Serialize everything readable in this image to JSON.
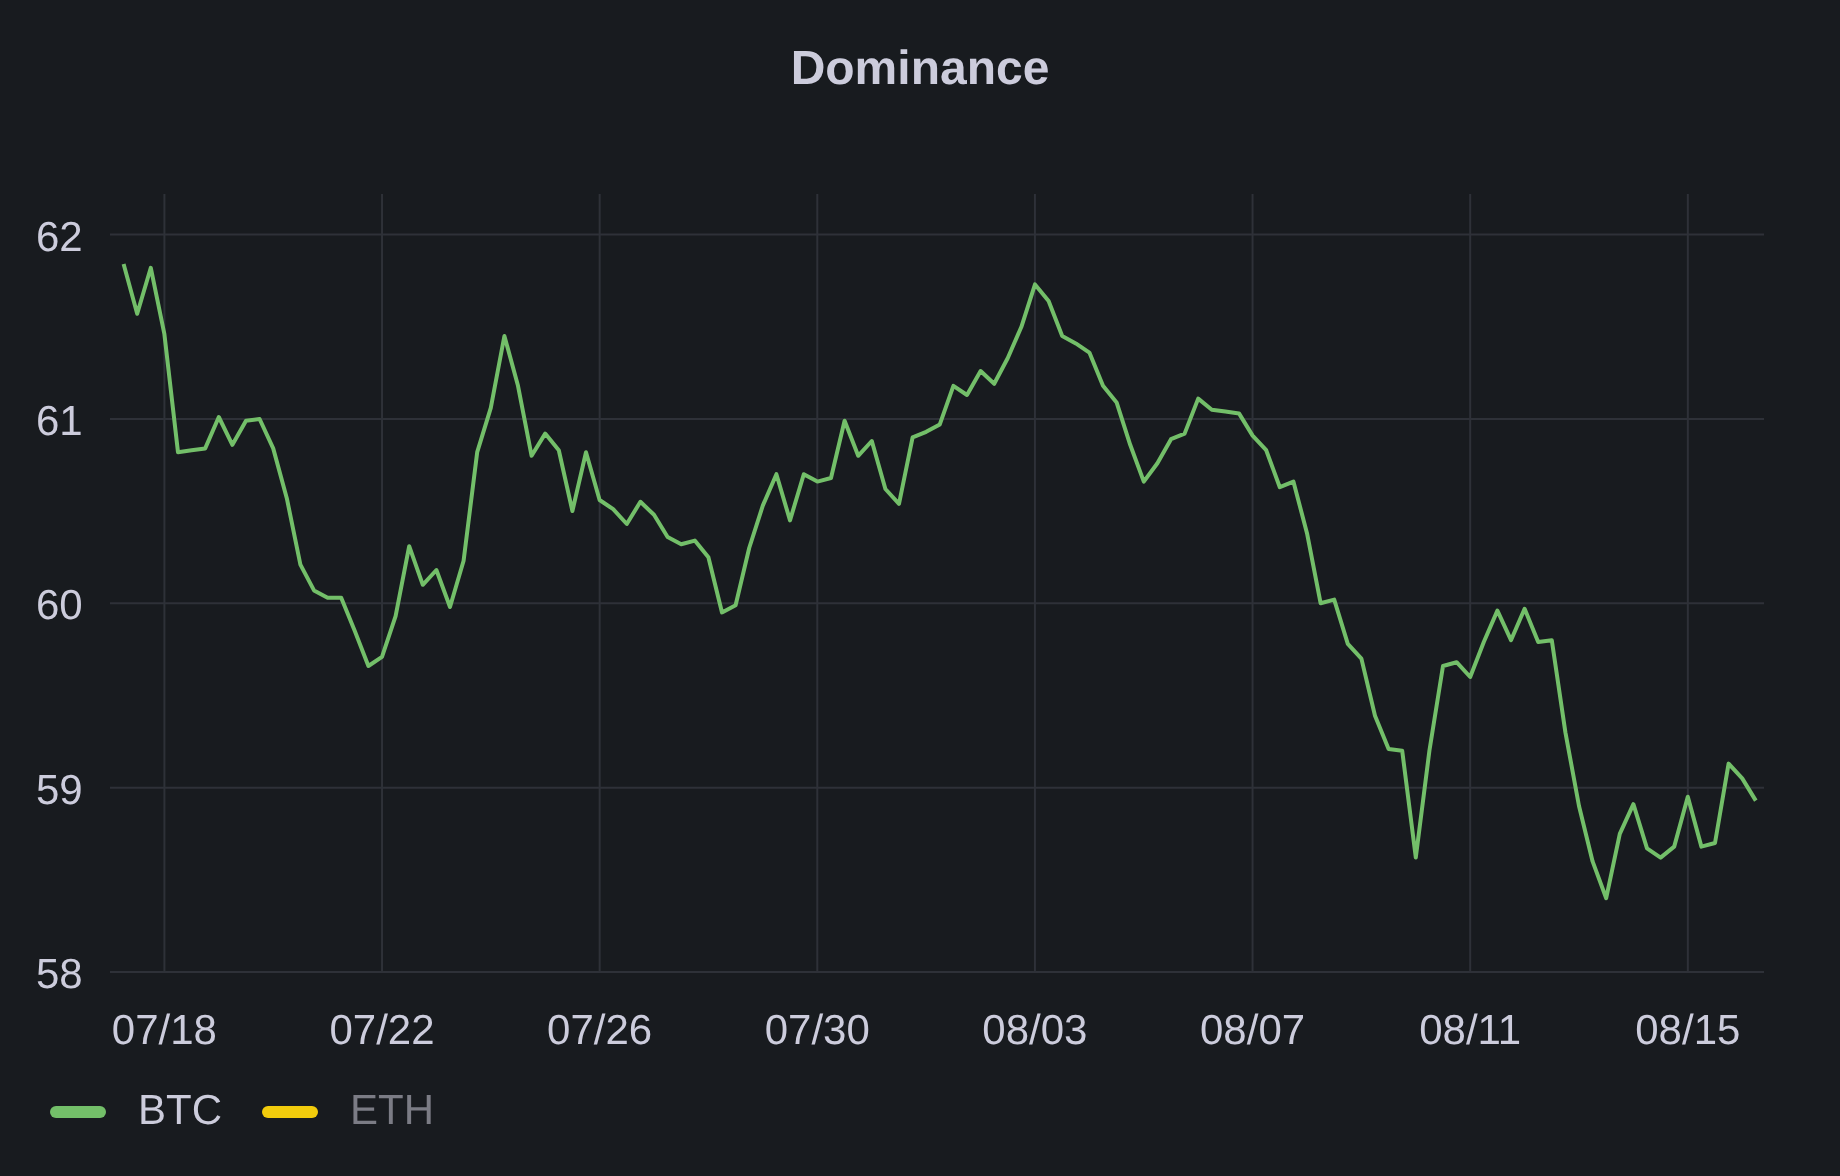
{
  "panel": {
    "title": "Dominance",
    "chart_data": {
      "type": "line",
      "grid": true,
      "ylim": [
        58,
        62.22
      ],
      "yticks": [
        58,
        59,
        60,
        61,
        62
      ],
      "categories": [
        null,
        null,
        null,
        "07/18",
        null,
        null,
        null,
        null,
        null,
        null,
        null,
        null,
        null,
        null,
        null,
        null,
        null,
        null,
        null,
        "07/22",
        null,
        null,
        null,
        null,
        null,
        null,
        null,
        null,
        null,
        null,
        null,
        null,
        null,
        null,
        null,
        "07/26",
        null,
        null,
        null,
        null,
        null,
        null,
        null,
        null,
        null,
        null,
        null,
        null,
        null,
        null,
        null,
        "07/30",
        null,
        null,
        null,
        null,
        null,
        null,
        null,
        null,
        null,
        null,
        null,
        null,
        null,
        null,
        null,
        "08/03",
        null,
        null,
        null,
        null,
        null,
        null,
        null,
        null,
        null,
        null,
        null,
        null,
        null,
        null,
        null,
        "08/07",
        null,
        null,
        null,
        null,
        null,
        null,
        null,
        null,
        null,
        null,
        null,
        null,
        null,
        null,
        null,
        "08/11",
        null,
        null,
        null,
        null,
        null,
        null,
        null,
        null,
        null,
        null,
        null,
        null,
        null,
        null,
        null,
        "08/15",
        null,
        null,
        null,
        null,
        null
      ],
      "series": [
        {
          "name": "BTC",
          "color": "#73bf69",
          "values": [
            61.84,
            61.57,
            61.82,
            61.46,
            60.82,
            60.83,
            60.84,
            61.01,
            60.86,
            60.99,
            61.0,
            60.84,
            60.57,
            60.21,
            60.07,
            60.03,
            60.03,
            59.85,
            59.66,
            59.71,
            59.93,
            60.31,
            60.1,
            60.18,
            59.98,
            60.23,
            60.82,
            61.06,
            61.45,
            61.18,
            60.8,
            60.92,
            60.83,
            60.5,
            60.82,
            60.56,
            60.51,
            60.43,
            60.55,
            60.48,
            60.36,
            60.32,
            60.34,
            60.25,
            59.95,
            59.99,
            60.3,
            60.53,
            60.7,
            60.45,
            60.7,
            60.66,
            60.68,
            60.99,
            60.8,
            60.88,
            60.62,
            60.54,
            60.9,
            60.93,
            60.97,
            61.18,
            61.13,
            61.26,
            61.19,
            61.33,
            61.5,
            61.73,
            61.64,
            61.45,
            61.41,
            61.36,
            61.18,
            61.09,
            60.86,
            60.66,
            60.76,
            60.89,
            60.92,
            61.11,
            61.05,
            61.04,
            61.03,
            60.91,
            60.83,
            60.63,
            60.66,
            60.38,
            60.0,
            60.02,
            59.78,
            59.7,
            59.39,
            59.21,
            59.2,
            58.62,
            59.2,
            59.66,
            59.68,
            59.6,
            59.79,
            59.96,
            59.8,
            59.97,
            59.79,
            59.8,
            59.3,
            58.9,
            58.6,
            58.4,
            58.75,
            58.91,
            58.67,
            58.62,
            58.68,
            58.95,
            58.68,
            58.7,
            59.13,
            59.05,
            58.93
          ]
        },
        {
          "name": "ETH",
          "color": "#f2cc0c",
          "values": [
            null,
            null,
            null,
            null,
            null,
            null,
            null,
            null,
            null,
            null,
            null,
            null,
            null,
            null,
            null,
            null,
            null,
            null,
            null,
            null,
            null,
            null,
            null,
            null,
            null,
            null,
            null,
            null,
            null,
            null,
            null,
            null,
            null,
            null,
            null,
            null,
            null,
            null,
            null,
            null,
            null,
            null,
            null,
            null,
            null,
            null,
            null,
            null,
            null,
            null,
            null,
            null,
            null,
            null,
            null,
            null,
            null,
            null,
            null,
            null,
            null,
            null,
            null,
            null,
            null,
            null,
            null,
            null,
            null,
            null,
            null,
            null,
            null,
            null,
            null,
            null,
            null,
            null,
            null,
            null,
            null,
            null,
            null,
            null,
            null,
            null,
            null,
            null,
            null,
            null,
            null,
            null,
            null,
            null,
            null,
            null,
            null,
            null,
            null,
            null,
            null,
            null,
            null,
            null,
            null,
            null,
            null,
            null,
            null,
            null,
            null,
            null,
            null,
            null,
            null,
            null,
            null,
            null,
            null,
            null,
            null
          ]
        }
      ]
    }
  }
}
